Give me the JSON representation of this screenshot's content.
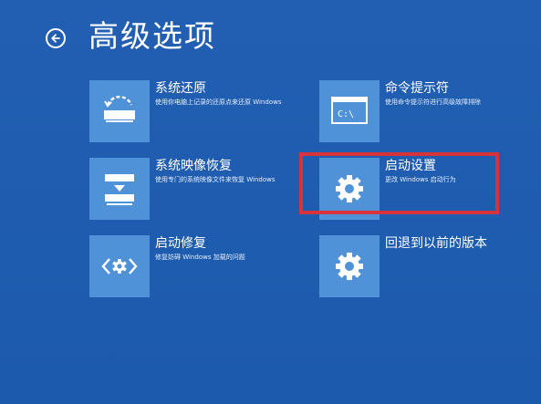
{
  "page": {
    "title": "高级选项"
  },
  "options": [
    {
      "id": "system-restore",
      "label": "系统还原",
      "desc": "使用你电脑上记录的还原点来还原 Windows",
      "icon": "system-restore-icon"
    },
    {
      "id": "command-prompt",
      "label": "命令提示符",
      "desc": "使用命令提示符进行高级故障排除",
      "icon": "command-prompt-icon"
    },
    {
      "id": "system-image-recovery",
      "label": "系统映像恢复",
      "desc": "使用专门的系统映像文件来恢复 Windows",
      "icon": "system-image-icon"
    },
    {
      "id": "startup-settings",
      "label": "启动设置",
      "desc": "更改 Windows 启动行为",
      "icon": "gear-icon"
    },
    {
      "id": "startup-repair",
      "label": "启动修复",
      "desc": "修复妨碍 Windows 加载的问题",
      "icon": "startup-repair-icon"
    },
    {
      "id": "go-back",
      "label": "回退到以前的版本",
      "desc": "",
      "icon": "gear-icon"
    }
  ],
  "colors": {
    "background": "#1f5fb3",
    "tile": "#4f92d8",
    "highlight": "#d8323a",
    "text": "#ffffff"
  }
}
